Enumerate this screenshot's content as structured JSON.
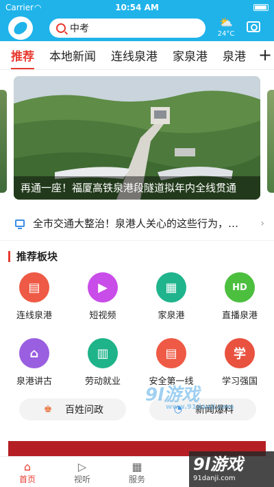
{
  "status_bar": {
    "carrier": "Carrier",
    "time": "10:54 AM"
  },
  "header": {
    "search_value": "中考",
    "weather_temp": "24°C",
    "weather_icon": "partly-cloudy-icon",
    "camera_icon": "camera-icon"
  },
  "tabs": [
    {
      "label": "推荐",
      "active": true
    },
    {
      "label": "本地新闻"
    },
    {
      "label": "连线泉港"
    },
    {
      "label": "家泉港"
    },
    {
      "label": "泉港"
    }
  ],
  "tabs_plus": "+",
  "banner": {
    "caption": "再通一座！福厦高铁泉港段隧道拟年内全线贯通"
  },
  "ticker": {
    "text": "全市交通大整治！泉港人关心的这些行为，…"
  },
  "section": {
    "title": "推荐板块"
  },
  "grid_items": [
    {
      "label": "连线泉港",
      "icon": "newspaper-icon",
      "color": "#ee5a45"
    },
    {
      "label": "短视频",
      "icon": "video-icon",
      "color": "#c94de8"
    },
    {
      "label": "家泉港",
      "icon": "building-icon",
      "color": "#20b48d"
    },
    {
      "label": "直播泉港",
      "icon": "live-camera-icon",
      "color": "#4cbf3f"
    },
    {
      "label": "泉港讲古",
      "icon": "house-icon",
      "color": "#9a5fe0"
    },
    {
      "label": "劳动就业",
      "icon": "factory-icon",
      "color": "#1fb38a"
    },
    {
      "label": "安全第一线",
      "icon": "document-icon",
      "color": "#ee5a45"
    },
    {
      "label": "学习强国",
      "icon": "study-icon",
      "color": "#e8523f"
    }
  ],
  "grid_glyphs": [
    "▤",
    "▶",
    "▦",
    "HD",
    "⌂",
    "▥",
    "▤",
    "学"
  ],
  "actions": [
    {
      "label": "百姓问政",
      "icon": "people-icon"
    },
    {
      "label": "新闻爆料",
      "icon": "megaphone-icon"
    }
  ],
  "bottom_tabs": [
    {
      "label": "首页",
      "icon": "home-icon",
      "active": true
    },
    {
      "label": "视听",
      "icon": "play-icon"
    },
    {
      "label": "服务",
      "icon": "grid-icon"
    }
  ],
  "watermarks": {
    "mid_big": "9l游戏",
    "mid_small": "www.91danji.com",
    "corner_big": "9l游戏",
    "corner_small": "91danji.com"
  }
}
